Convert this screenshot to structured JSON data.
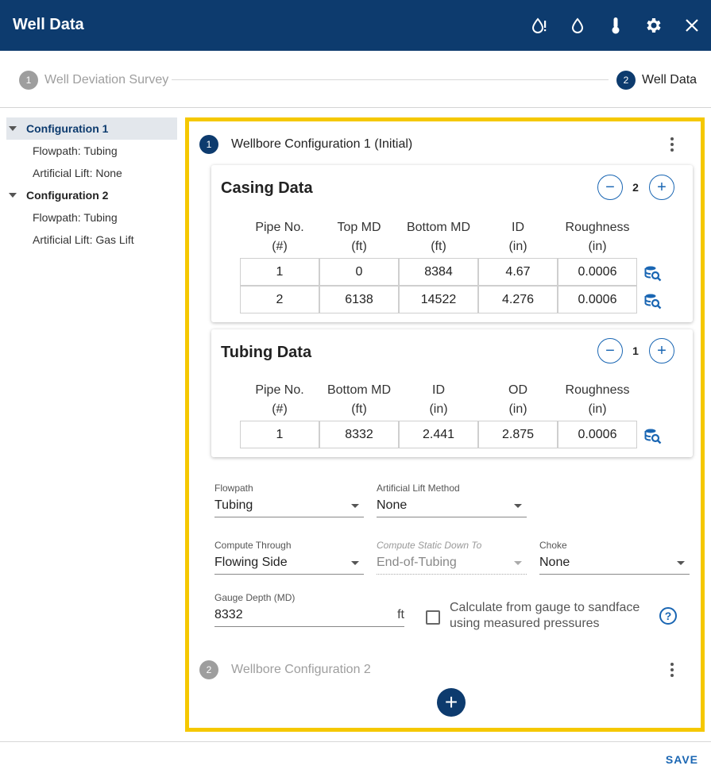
{
  "window": {
    "title": "Well Data",
    "icons": [
      "droplet-alert-icon",
      "droplet-icon",
      "thermometer-icon",
      "gear-icon",
      "close-icon"
    ]
  },
  "stepper": {
    "steps": [
      {
        "number": "1",
        "label": "Well Deviation Survey",
        "active": false
      },
      {
        "number": "2",
        "label": "Well Data",
        "active": true
      }
    ]
  },
  "sidebar": {
    "items": [
      {
        "label": "Configuration 1",
        "level": 0,
        "selected": true
      },
      {
        "label": "Flowpath: Tubing",
        "level": 1
      },
      {
        "label": "Artificial Lift: None",
        "level": 1
      },
      {
        "label": "Configuration 2",
        "level": 0
      },
      {
        "label": "Flowpath: Tubing",
        "level": 1
      },
      {
        "label": "Artificial Lift: Gas Lift",
        "level": 1
      }
    ]
  },
  "config1": {
    "number": "1",
    "title": "Wellbore Configuration 1 (Initial)",
    "casing": {
      "title": "Casing Data",
      "count": "2",
      "headers": [
        [
          "Pipe No.",
          "(#)"
        ],
        [
          "Top MD",
          "(ft)"
        ],
        [
          "Bottom MD",
          "(ft)"
        ],
        [
          "ID",
          "(in)"
        ],
        [
          "Roughness",
          "(in)"
        ]
      ],
      "rows": [
        [
          "1",
          "0",
          "8384",
          "4.67",
          "0.0006"
        ],
        [
          "2",
          "6138",
          "14522",
          "4.276",
          "0.0006"
        ]
      ]
    },
    "tubing": {
      "title": "Tubing Data",
      "count": "1",
      "headers": [
        [
          "Pipe No.",
          "(#)"
        ],
        [
          "Bottom MD",
          "(ft)"
        ],
        [
          "ID",
          "(in)"
        ],
        [
          "OD",
          "(in)"
        ],
        [
          "Roughness",
          "(in)"
        ]
      ],
      "rows": [
        [
          "1",
          "8332",
          "2.441",
          "2.875",
          "0.0006"
        ]
      ]
    },
    "fields": {
      "flowpath": {
        "label": "Flowpath",
        "value": "Tubing"
      },
      "artificial_lift": {
        "label": "Artificial Lift Method",
        "value": "None"
      },
      "compute_through": {
        "label": "Compute Through",
        "value": "Flowing Side"
      },
      "compute_static": {
        "label": "Compute Static Down To",
        "value": "End-of-Tubing"
      },
      "choke": {
        "label": "Choke",
        "value": "None"
      },
      "gauge_depth": {
        "label": "Gauge Depth (MD)",
        "value": "8332",
        "unit": "ft"
      }
    },
    "checkbox_label": "Calculate from gauge to sandface using measured pressures",
    "checkbox_checked": false
  },
  "config2": {
    "number": "2",
    "title": "Wellbore Configuration 2"
  },
  "footer": {
    "save_label": "SAVE"
  },
  "colors": {
    "header_bg": "#0d3b6e",
    "accent": "#1a66b3",
    "highlight_border": "#f5c800",
    "inactive_step": "#9e9e9e"
  }
}
